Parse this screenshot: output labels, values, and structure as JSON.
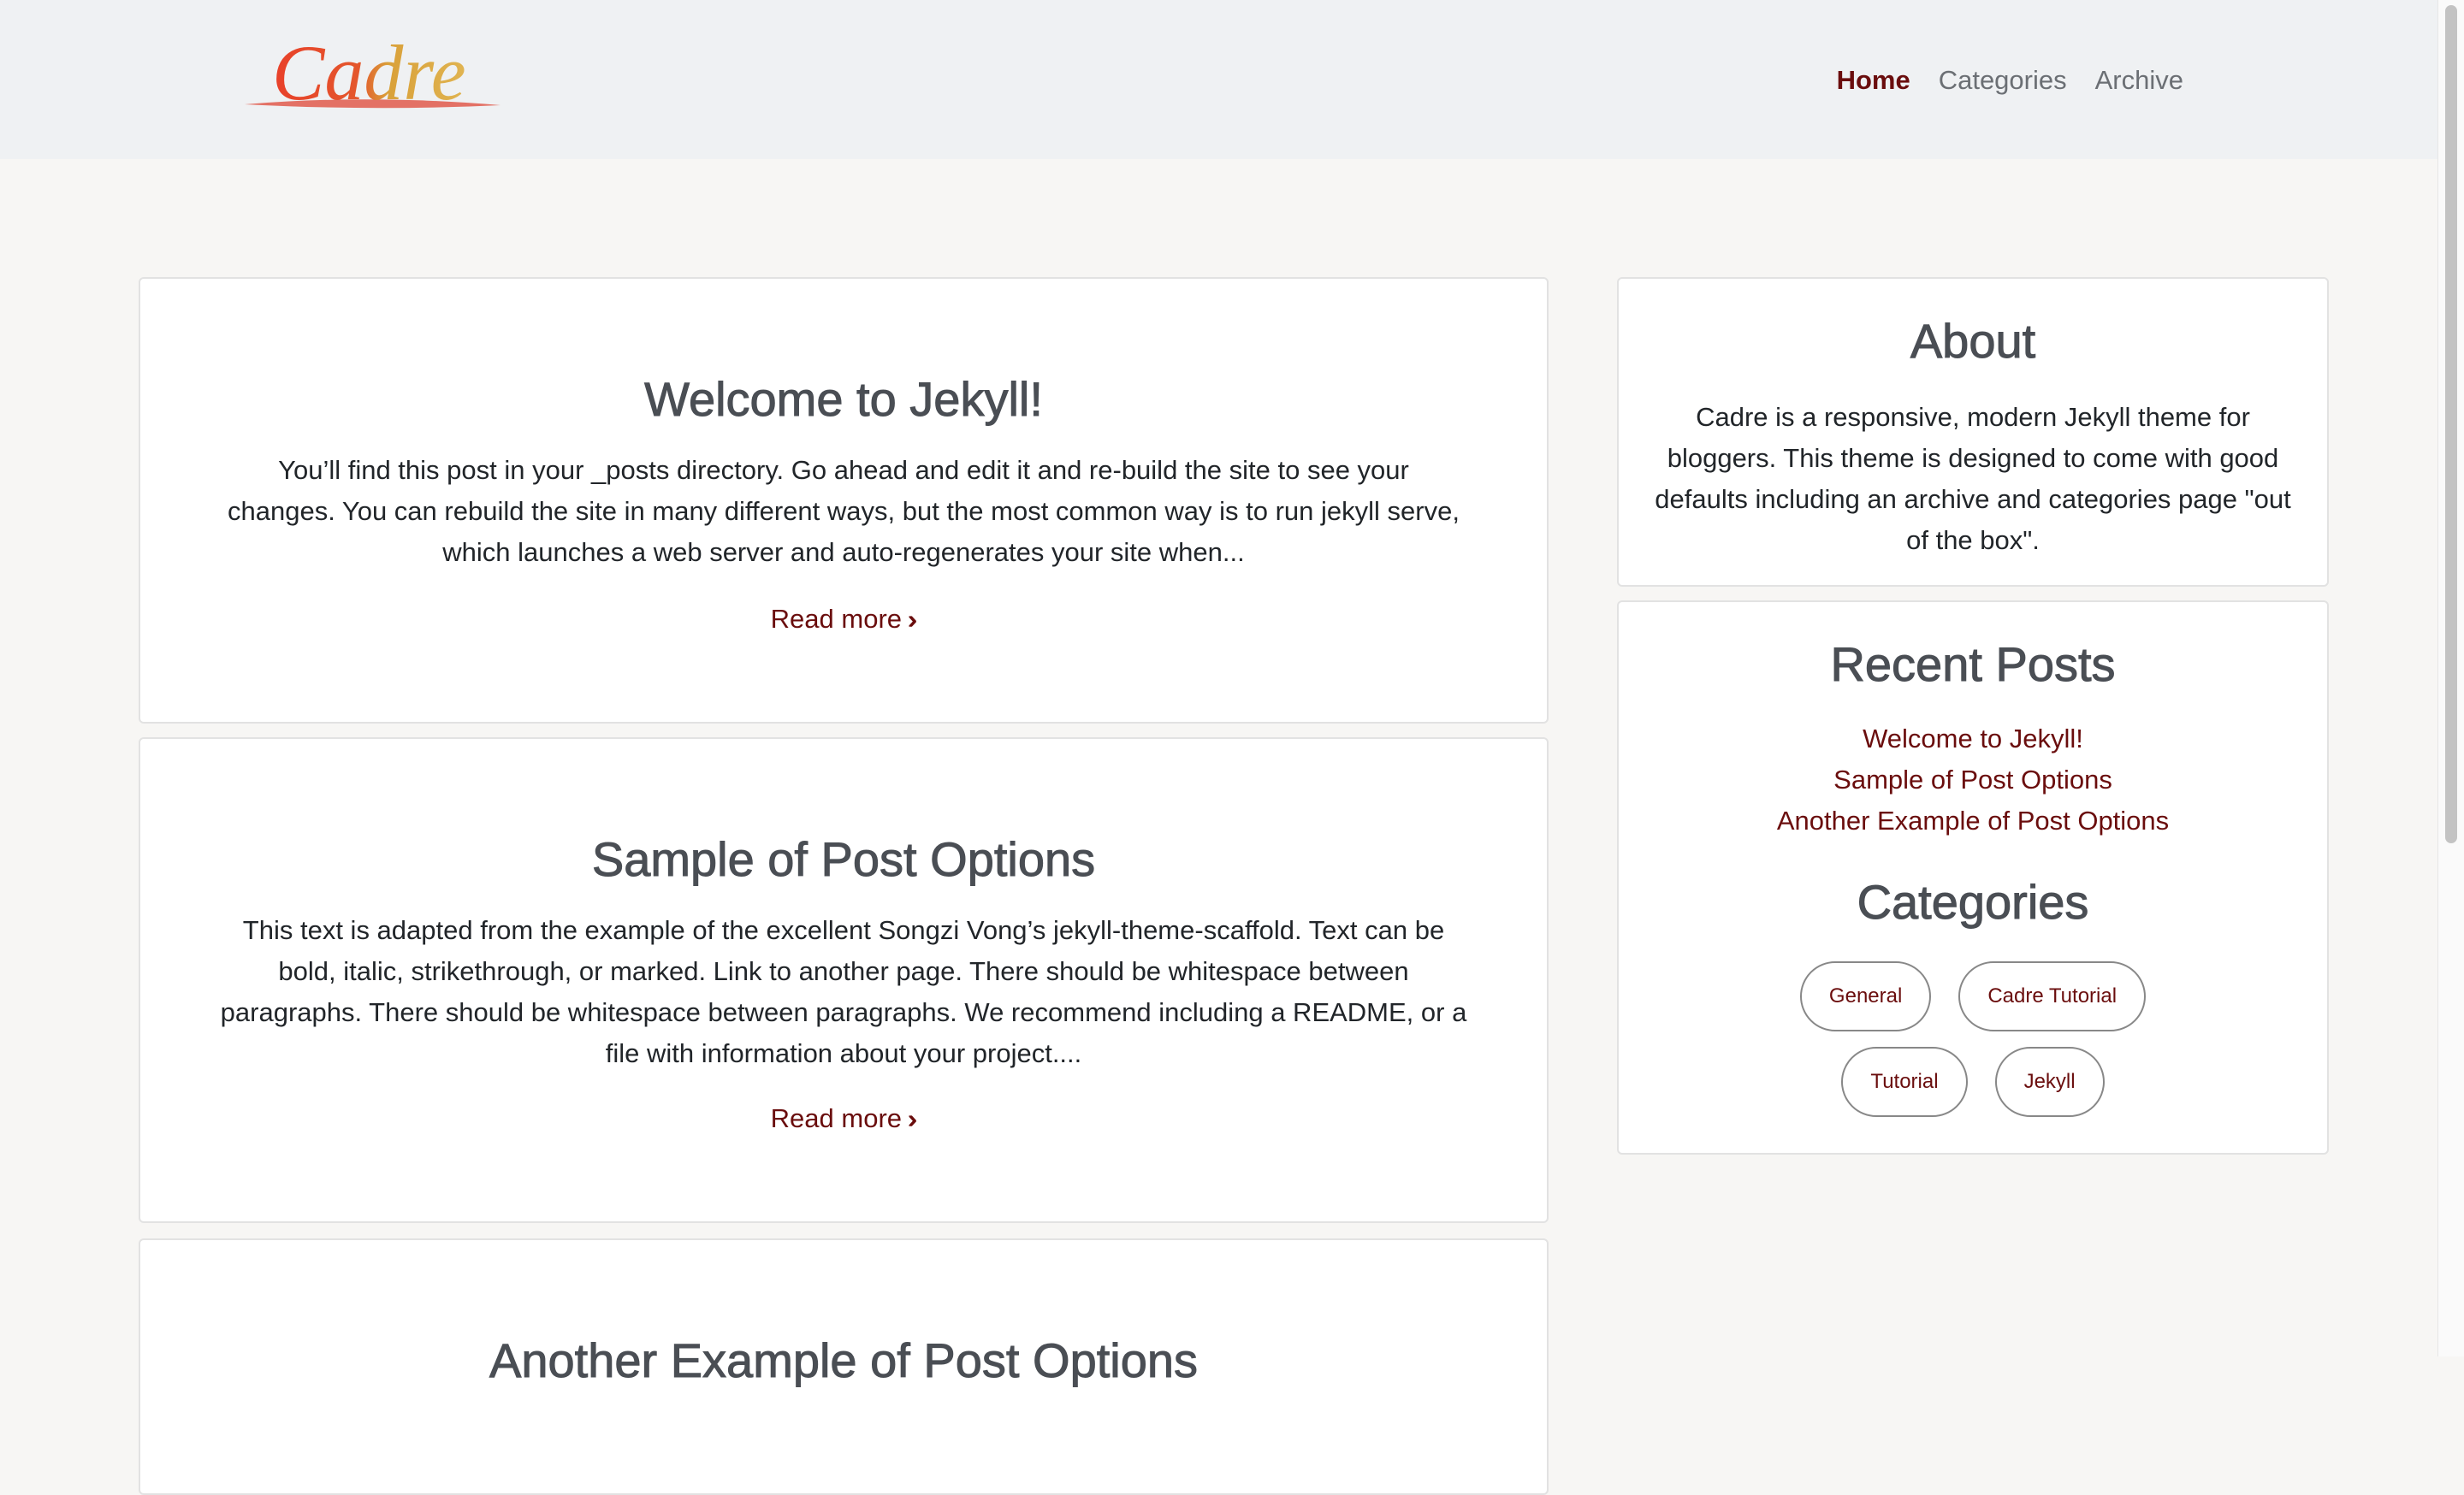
{
  "header": {
    "logo_text": "Cadre",
    "nav": [
      {
        "label": "Home",
        "active": true
      },
      {
        "label": "Categories",
        "active": false
      },
      {
        "label": "Archive",
        "active": false
      }
    ]
  },
  "posts": [
    {
      "title": "Welcome to Jekyll!",
      "excerpt": "You’ll find this post in your _posts directory. Go ahead and edit it and re-build the site to see your changes. You can rebuild the site in many different ways, but the most common way is to run jekyll serve, which launches a web server and auto-regenerates your site when...",
      "read_more": "Read more"
    },
    {
      "title": "Sample of Post Options",
      "excerpt": "This text is adapted from the example of the excellent Songzi Vong’s jekyll-theme-scaffold. Text can be bold, italic, strikethrough, or marked. Link to another page. There should be whitespace between paragraphs. There should be whitespace between paragraphs. We recommend including a README, or a file with information about your project....",
      "read_more": "Read more"
    },
    {
      "title": "Another Example of Post Options"
    }
  ],
  "sidebar": {
    "about": {
      "heading": "About",
      "text": "Cadre is a responsive, modern Jekyll theme for bloggers. This theme is designed to come with good defaults including an archive and categories page \"out of the box\"."
    },
    "recent": {
      "heading": "Recent Posts",
      "items": [
        "Welcome to Jekyll!",
        "Sample of Post Options",
        "Another Example of Post Options"
      ]
    },
    "categories": {
      "heading": "Categories",
      "tags": [
        "General",
        "Cadre Tutorial",
        "Tutorial",
        "Jekyll"
      ]
    }
  },
  "colors": {
    "accent": "#6a0d0d",
    "heading": "#4a4e54",
    "navbar_bg": "#eff1f3",
    "page_bg": "#f7f6f4"
  }
}
